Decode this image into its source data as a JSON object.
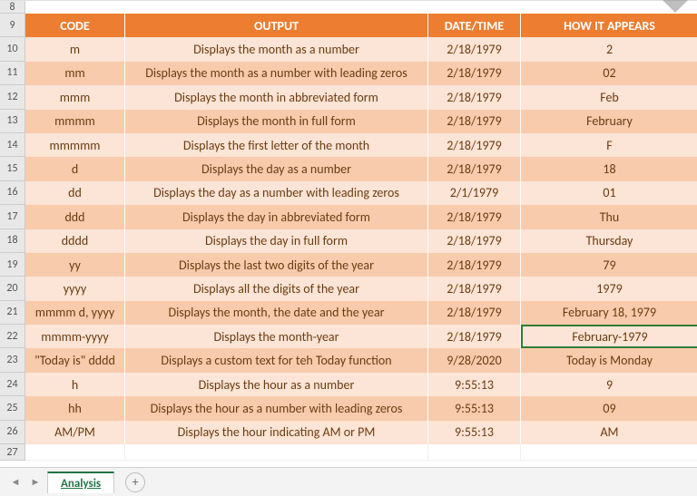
{
  "row_numbers": [
    "8",
    "9",
    "10",
    "11",
    "12",
    "13",
    "14",
    "15",
    "16",
    "17",
    "18",
    "19",
    "20",
    "21",
    "22",
    "23",
    "24",
    "25",
    "26",
    "27"
  ],
  "headers": {
    "code": "CODE",
    "output": "OUTPUT",
    "datetime": "DATE/TIME",
    "appears": "HOW IT APPEARS"
  },
  "rows": [
    {
      "code": "m",
      "output": "Displays the month as a number",
      "datetime": "2/18/1979",
      "appears": "2"
    },
    {
      "code": "mm",
      "output": "Displays the month as a number with leading zeros",
      "datetime": "2/18/1979",
      "appears": "02"
    },
    {
      "code": "mmm",
      "output": "Displays the month in abbreviated form",
      "datetime": "2/18/1979",
      "appears": "Feb"
    },
    {
      "code": "mmmm",
      "output": "Displays the month in full form",
      "datetime": "2/18/1979",
      "appears": "February"
    },
    {
      "code": "mmmmm",
      "output": "Displays the first letter of the month",
      "datetime": "2/18/1979",
      "appears": "F"
    },
    {
      "code": "d",
      "output": "Displays the day as a number",
      "datetime": "2/18/1979",
      "appears": "18"
    },
    {
      "code": "dd",
      "output": "Displays the day as a number with leading zeros",
      "datetime": "2/1/1979",
      "appears": "01"
    },
    {
      "code": "ddd",
      "output": "Displays the day in abbreviated form",
      "datetime": "2/18/1979",
      "appears": "Thu"
    },
    {
      "code": "dddd",
      "output": "Displays the day in full form",
      "datetime": "2/18/1979",
      "appears": "Thursday"
    },
    {
      "code": "yy",
      "output": "Displays the last two digits of the year",
      "datetime": "2/18/1979",
      "appears": "79"
    },
    {
      "code": "yyyy",
      "output": "Displays all the digits of the year",
      "datetime": "2/18/1979",
      "appears": "1979"
    },
    {
      "code": "mmmm d, yyyy",
      "output": "Displays the month, the date and the year",
      "datetime": "2/18/1979",
      "appears": "February 18, 1979"
    },
    {
      "code": "mmmm-yyyy",
      "output": "Displays the month-year",
      "datetime": "2/18/1979",
      "appears": "February-1979"
    },
    {
      "code": "\"Today is\" dddd",
      "output": "Displays a custom text for teh Today function",
      "datetime": "9/28/2020",
      "appears": "Today is Monday"
    },
    {
      "code": "h",
      "output": "Displays the hour as a number",
      "datetime": "9:55:13",
      "appears": "9"
    },
    {
      "code": "hh",
      "output": "Displays the hour as a number with leading zeros",
      "datetime": "9:55:13",
      "appears": "09"
    },
    {
      "code": "AM/PM",
      "output": "Displays the hour indicating AM or PM",
      "datetime": "9:55:13",
      "appears": "AM"
    }
  ],
  "selected_row_index": 12,
  "tabs": {
    "active": "Analysis"
  },
  "colors": {
    "header_bg": "#ed7d31",
    "band_a": "#fce4d6",
    "band_b": "#f8cbad",
    "text": "#6b3c0f"
  }
}
